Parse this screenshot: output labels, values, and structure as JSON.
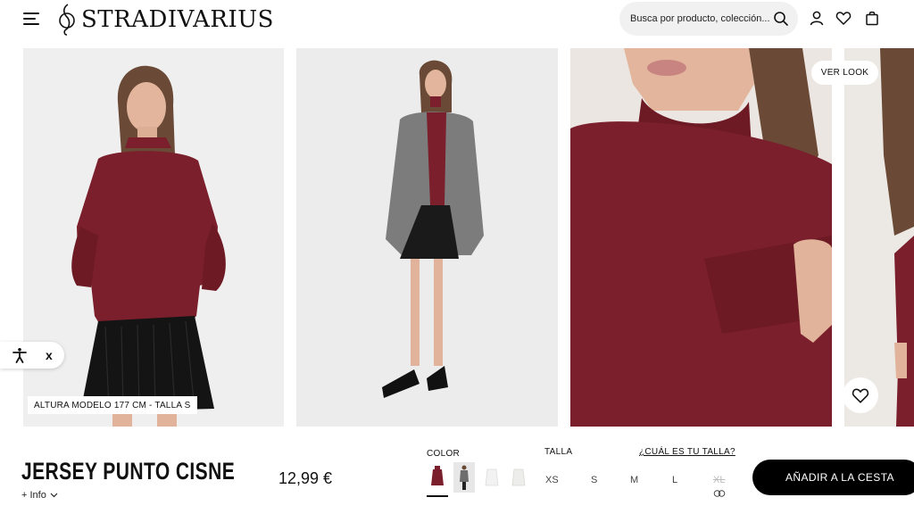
{
  "header": {
    "brand": "STRADIVARIUS",
    "search_placeholder": "Busca por producto, colección..."
  },
  "icons": {
    "menu": "menu-icon",
    "search": "search-icon",
    "account": "user-icon",
    "wishlist": "heart-icon",
    "bag": "shopping-bag-icon",
    "accessibility": "accessibility-icon"
  },
  "gallery": {
    "ver_look_label": "VER LOOK",
    "model_info": "ALTURA MODELO 177 CM - TALLA S"
  },
  "accessibility_widget": {
    "close_label": "x"
  },
  "product": {
    "name": "JERSEY PUNTO CISNE",
    "info_label": "+ Info",
    "price": "12,99 €",
    "color_label": "COLOR",
    "colors": [
      {
        "name": "burdeos",
        "hex": "#7a1f2b",
        "selected": true
      },
      {
        "name": "look",
        "hex": "#6d6d6d",
        "selected": false
      },
      {
        "name": "blanco",
        "hex": "#f2f2f2",
        "selected": false
      },
      {
        "name": "crudo",
        "hex": "#ededeb",
        "selected": false
      }
    ],
    "size_label": "TALLA",
    "size_guide_label": "¿CUÁL ES TU TALLA?",
    "sizes": [
      {
        "label": "XS",
        "available": true
      },
      {
        "label": "S",
        "available": true
      },
      {
        "label": "M",
        "available": true
      },
      {
        "label": "L",
        "available": true
      },
      {
        "label": "XL",
        "available": false
      }
    ],
    "add_to_cart_label": "AÑADIR A LA CESTA"
  },
  "colors": {
    "primary": "#000000",
    "sweater": "#7a1f2b",
    "background": "#ffffff"
  }
}
